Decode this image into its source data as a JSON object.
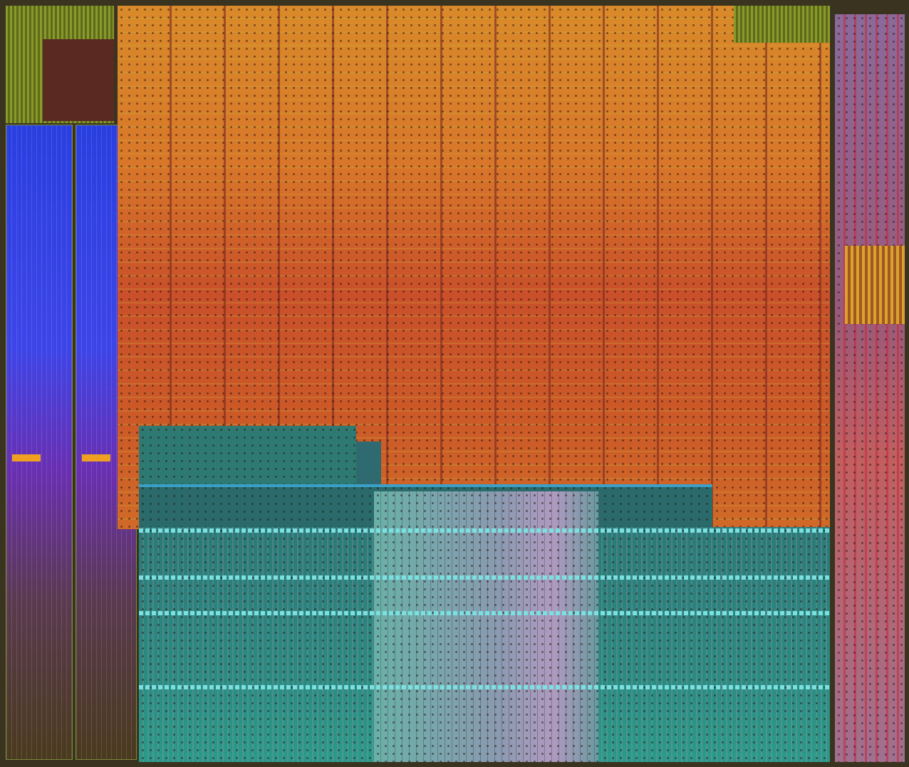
{
  "colors": {
    "orange_region": "#d8772a",
    "blue_columns": "#2a3fe0",
    "teal_region": "#2a7a78",
    "right_strip": "#9a5a7a"
  }
}
